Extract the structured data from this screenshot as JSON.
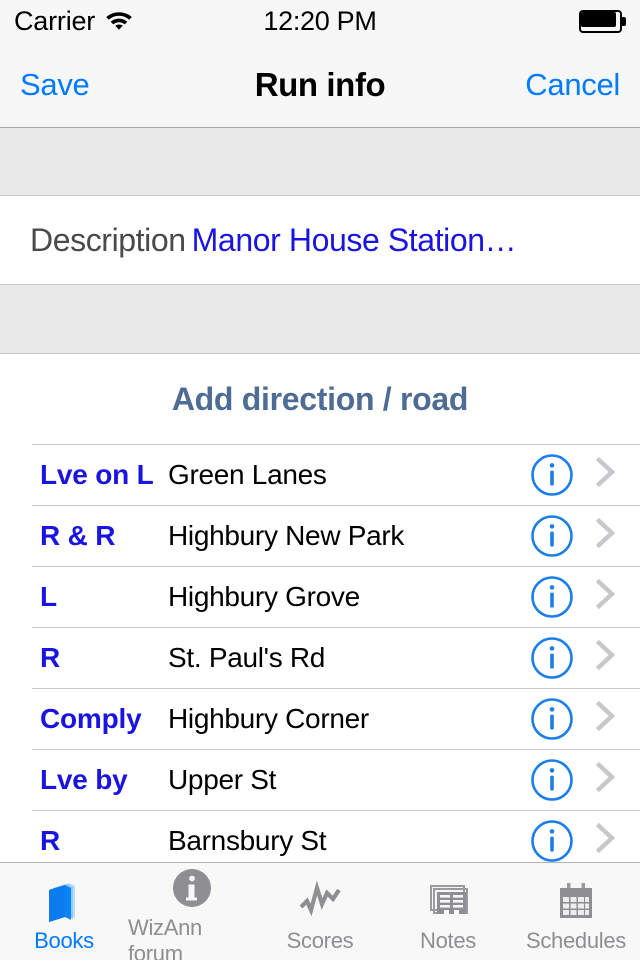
{
  "status_bar": {
    "carrier": "Carrier",
    "wifi_icon": "wifi-icon",
    "time": "12:20 PM",
    "battery_icon": "battery-full-icon"
  },
  "nav_bar": {
    "left_button": "Save",
    "title": "Run info",
    "right_button": "Cancel"
  },
  "description_row": {
    "label": "Description",
    "value": "Manor House Station…"
  },
  "section": {
    "header": "Add direction / road",
    "rows": [
      {
        "direction": "Lve on L",
        "road": "Green Lanes",
        "info_icon": "info-circle-icon",
        "chevron_icon": "chevron-right-icon"
      },
      {
        "direction": "R & R",
        "road": "Highbury New Park",
        "info_icon": "info-circle-icon",
        "chevron_icon": "chevron-right-icon"
      },
      {
        "direction": "L",
        "road": "Highbury Grove",
        "info_icon": "info-circle-icon",
        "chevron_icon": "chevron-right-icon"
      },
      {
        "direction": "R",
        "road": "St. Paul's Rd",
        "info_icon": "info-circle-icon",
        "chevron_icon": "chevron-right-icon"
      },
      {
        "direction": "Comply",
        "road": "Highbury Corner",
        "info_icon": "info-circle-icon",
        "chevron_icon": "chevron-right-icon"
      },
      {
        "direction": "Lve by",
        "road": "Upper St",
        "info_icon": "info-circle-icon",
        "chevron_icon": "chevron-right-icon"
      },
      {
        "direction": "R",
        "road": "Barnsbury St",
        "info_icon": "info-circle-icon",
        "chevron_icon": "chevron-right-icon"
      }
    ]
  },
  "tab_bar": {
    "active_index": 0,
    "tabs": [
      {
        "label": "Books",
        "icon": "books-icon"
      },
      {
        "label": "WizAnn forum",
        "icon": "info-filled-icon"
      },
      {
        "label": "Scores",
        "icon": "zigzag-chart-icon"
      },
      {
        "label": "Notes",
        "icon": "stacked-notes-icon"
      },
      {
        "label": "Schedules",
        "icon": "calendar-icon"
      }
    ]
  },
  "colors": {
    "tint_blue": "#007aff",
    "link_blue": "#1a14e0",
    "header_slate": "#4f6c94",
    "separator": "#c8c7cc",
    "group_bg": "#e9e9e9",
    "bar_bg": "#f7f7f7",
    "inactive_gray": "#8e8e93"
  }
}
